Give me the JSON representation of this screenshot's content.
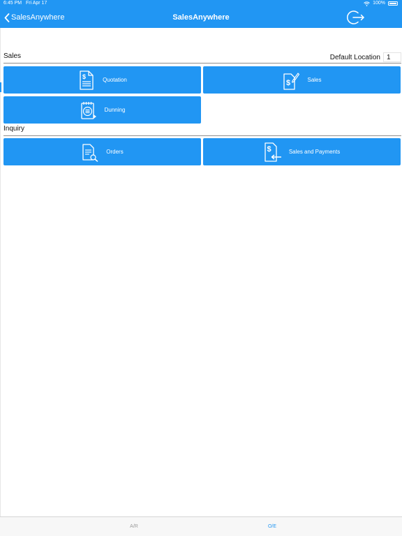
{
  "status_bar": {
    "time": "6:45 PM",
    "date": "Fri Apr 17",
    "battery": "100%"
  },
  "nav": {
    "back_label": "SalesAnywhere",
    "title": "SalesAnywhere"
  },
  "sales_section": {
    "title": "Sales",
    "default_location_label": "Default Location",
    "default_location_value": "1",
    "tiles": [
      {
        "label": "Quotation",
        "icon": "quotation-document-icon"
      },
      {
        "label": "Sales",
        "icon": "sales-document-icon"
      },
      {
        "label": "Dunning",
        "icon": "dunning-notepad-icon"
      }
    ]
  },
  "inquiry_section": {
    "title": "Inquiry",
    "tiles": [
      {
        "label": "Orders",
        "icon": "orders-search-icon"
      },
      {
        "label": "Sales and Payments",
        "icon": "sales-payments-icon"
      }
    ]
  },
  "tab_bar": {
    "tabs": [
      {
        "label": "A/R",
        "active": false
      },
      {
        "label": "O/E",
        "active": true
      }
    ]
  },
  "colors": {
    "accent": "#2196F3",
    "tab_inactive": "#9A9A9A"
  }
}
